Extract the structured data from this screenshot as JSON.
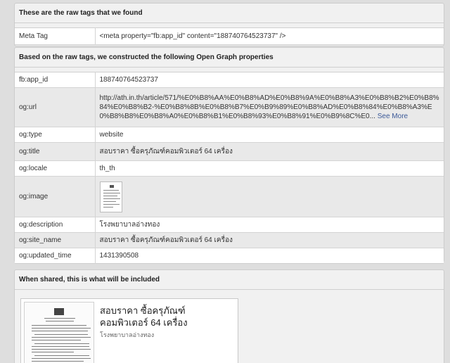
{
  "raw_section": {
    "header": "These are the raw tags that we found",
    "rows": [
      {
        "key": "Meta Tag",
        "value": "<meta property=\"fb:app_id\" content=\"188740764523737\" />"
      }
    ]
  },
  "og_section": {
    "header": "Based on the raw tags, we constructed the following Open Graph properties",
    "app_id_key": "fb:app_id",
    "app_id": "188740764523737",
    "url_key": "og:url",
    "url": "http://ath.in.th/article/571/%E0%B8%AA%E0%B8%AD%E0%B8%9A%E0%B8%A3%E0%B8%B2%E0%B8%84%E0%B8%B2-%E0%B8%8B%E0%B8%B7%E0%B9%89%E0%B8%AD%E0%B8%84%E0%B8%A3%E0%B8%B8%E0%B8%A0%E0%B8%B1%E0%B8%93%E0%B8%91%E0%B9%8C%E0...",
    "see_more": "See More",
    "type_key": "og:type",
    "type": "website",
    "title_key": "og:title",
    "title": "สอบราคา ซื้อครุภัณฑ์คอมพิวเตอร์ 64 เครื่อง",
    "locale_key": "og:locale",
    "locale": "th_th",
    "image_key": "og:image",
    "image_icon": "document-thumbnail-icon",
    "description_key": "og:description",
    "description": "โรงพยาบาลอ่างทอง",
    "site_name_key": "og:site_name",
    "site_name": "สอบราคา ซื้อครุภัณฑ์คอมพิวเตอร์ 64 เครื่อง",
    "updated_time_key": "og:updated_time",
    "updated_time": "1431390508"
  },
  "share_section": {
    "header": "When shared, this is what will be included",
    "preview": {
      "image_icon": "document-preview-icon",
      "title": "สอบราคา ซื้อครุภัณฑ์คอมพิวเตอร์ 64 เครื่อง",
      "description": "โรงพยาบาลอ่างทอง"
    }
  },
  "colors": {
    "page_background": "#dedede",
    "panel_background": "#f1f1f1",
    "link": "#3b5998"
  }
}
